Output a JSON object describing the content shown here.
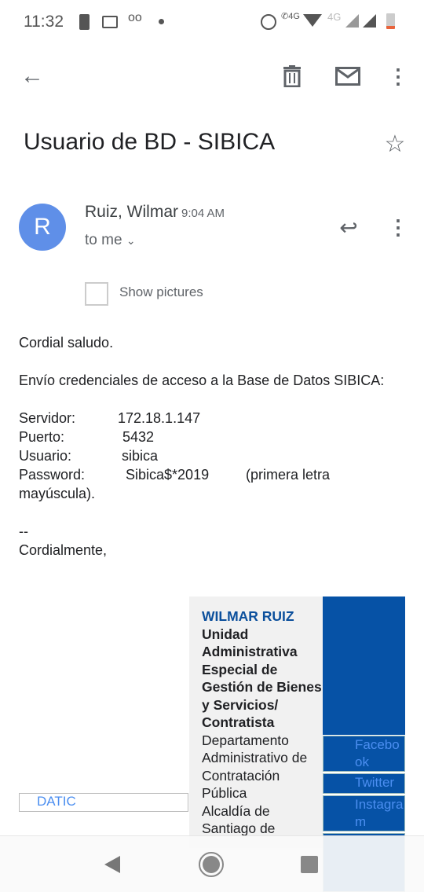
{
  "status_bar": {
    "time": "11:32",
    "network_label": "4G",
    "network_label_2": "4G",
    "icons": [
      "alert-icon",
      "gmail-icon",
      "voicemail-icon",
      "dot-icon",
      "alarm-icon",
      "wifi-call-icon",
      "wifi-icon",
      "signal-icon",
      "signal-icon",
      "battery-icon"
    ]
  },
  "toolbar": {
    "icons": [
      "back-arrow-icon",
      "trash-icon",
      "mail-icon",
      "more-vert-icon"
    ]
  },
  "email": {
    "subject": "Usuario de BD - SIBICA",
    "avatar_letter": "R",
    "sender": "Ruiz, Wilmar",
    "time": "9:04 AM",
    "recipient": "to me",
    "show_pictures": "Show pictures",
    "body": {
      "greeting": "Cordial saludo.",
      "intro": "Envío credenciales de acceso a la Base de Datos SIBICA:",
      "servidor_label": "Servidor:",
      "servidor": "172.18.1.147",
      "puerto_label": "Puerto:",
      "puerto": "5432",
      "usuario_label": "Usuario:",
      "usuario": "sibica",
      "password_label": "Password:",
      "password": "Sibica$*2019",
      "password_note": "(primera letra mayúscula).",
      "separator": "--",
      "closing": "Cordialmente,"
    },
    "signature": {
      "logo_alt": "DATIC",
      "name": "WILMAR RUIZ",
      "entity": "Unidad Administrativa Especial de Gestión de Bienes y Servicios/ Contratista",
      "department": "Departamento Administrativo de Contratación Pública",
      "city": "Alcaldía de Santiago de",
      "social": [
        "Facebook",
        "Twitter",
        "Instagram"
      ]
    }
  },
  "colors": {
    "accent": "#0652a6",
    "avatar": "#5f8fe8",
    "name": "#0b4f9c"
  }
}
